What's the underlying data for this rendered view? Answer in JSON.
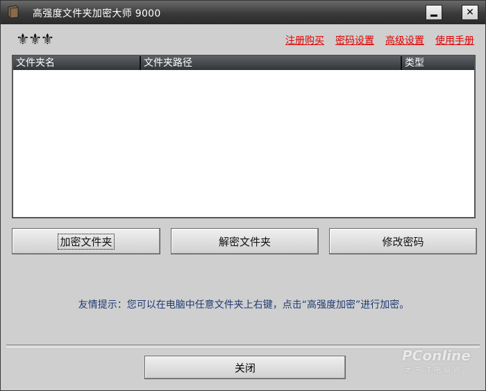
{
  "window": {
    "title": "高强度文件夹加密大师 9000"
  },
  "titlebar": {
    "minimize": "",
    "close": "✕"
  },
  "header": {
    "logo_glyphs": "⚜⚜⚜"
  },
  "links": [
    {
      "label": "注册购买"
    },
    {
      "label": "密码设置"
    },
    {
      "label": "高级设置"
    },
    {
      "label": "使用手册"
    }
  ],
  "table": {
    "columns": [
      "文件夹名",
      "文件夹路径",
      "类型"
    ],
    "rows": []
  },
  "actions": {
    "encrypt": "加密文件夹",
    "decrypt": "解密文件夹",
    "change_password": "修改密码"
  },
  "tip": "友情提示：您可以在电脑中任意文件夹上右键，点击“高强度加密”进行加密。",
  "footer": {
    "close_label": "关闭"
  },
  "watermark": {
    "brand": "PConline",
    "sub": "太平洋电脑网"
  },
  "colors": {
    "link": "#e00000",
    "tip": "#1e3a72",
    "titlebar": "#3a3a3a"
  }
}
